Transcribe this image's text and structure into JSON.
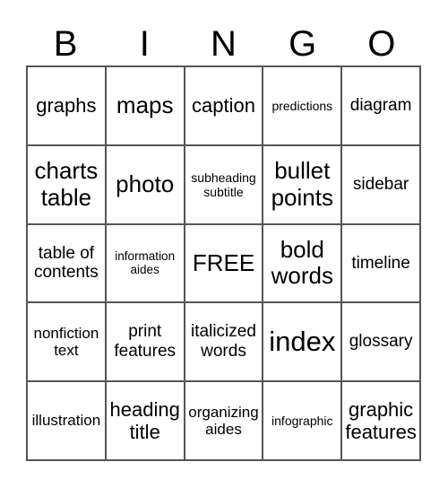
{
  "header": {
    "letters": [
      "B",
      "I",
      "N",
      "G",
      "O"
    ]
  },
  "grid": {
    "rows": [
      [
        "graphs",
        "maps",
        "caption",
        "predictions",
        "diagram"
      ],
      [
        "charts\ntable",
        "photo",
        "subheading\nsubtitle",
        "bullet\npoints",
        "sidebar"
      ],
      [
        "table of\ncontents",
        "information\naides",
        "FREE",
        "bold\nwords",
        "timeline"
      ],
      [
        "nonfiction\ntext",
        "print\nfeatures",
        "italicized\nwords",
        "index",
        "glossary"
      ],
      [
        "illustration",
        "heading\ntitle",
        "organizing\naides",
        "infographic",
        "graphic\nfeatures"
      ]
    ]
  }
}
